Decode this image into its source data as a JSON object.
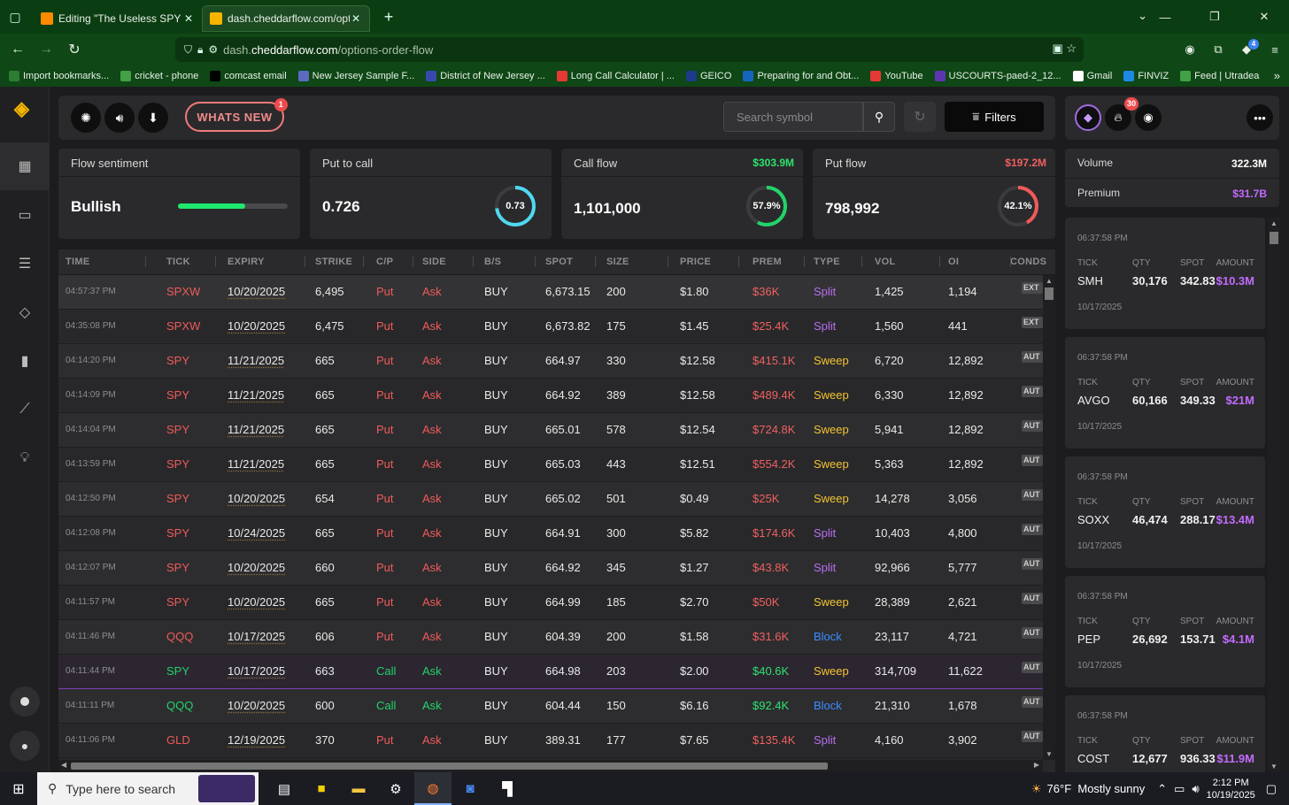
{
  "browser": {
    "tabs": [
      {
        "title": "Editing \"The Useless SPY Report\"",
        "active": false
      },
      {
        "title": "dash.cheddarflow.com/options-",
        "active": true
      }
    ],
    "url_prefix": "dash.",
    "url_domain": "cheddarflow.com",
    "url_path": "/options-order-flow",
    "bookmarks": [
      {
        "label": "Import bookmarks...",
        "color": "#2e7d32"
      },
      {
        "label": "cricket - phone",
        "color": "#43a047"
      },
      {
        "label": "comcast email",
        "color": "#000000"
      },
      {
        "label": "New Jersey Sample F...",
        "color": "#5c6bc0"
      },
      {
        "label": "District of New Jersey ...",
        "color": "#3949ab"
      },
      {
        "label": "Long Call Calculator | ...",
        "color": "#e53935"
      },
      {
        "label": "GEICO",
        "color": "#1e3a8a"
      },
      {
        "label": "Preparing for and Obt...",
        "color": "#1565c0"
      },
      {
        "label": "YouTube",
        "color": "#e53935"
      },
      {
        "label": "USCOURTS-paed-2_12...",
        "color": "#5e35b1"
      },
      {
        "label": "Gmail",
        "color": "#ffffff"
      },
      {
        "label": "FINVIZ",
        "color": "#1e88e5"
      },
      {
        "label": "Feed | Utradea",
        "color": "#43a047"
      }
    ],
    "ext_badge": "4"
  },
  "toolbar": {
    "whats_new_label": "WHATS NEW",
    "whats_new_badge": "1",
    "search_placeholder": "Search symbol",
    "filters_label": "Filters",
    "fire_badge": "30"
  },
  "summary": {
    "sentiment": {
      "label": "Flow sentiment",
      "value": "Bullish",
      "level": 0.61
    },
    "put_to_call": {
      "label": "Put to call",
      "value": "0.726",
      "ring_label": "0.73",
      "ring_fraction": 0.73
    },
    "call_flow": {
      "label": "Call flow",
      "amount": "$303.9M",
      "value": "1,101,000",
      "ring_label": "57.9%",
      "ring_fraction": 0.579
    },
    "put_flow": {
      "label": "Put flow",
      "amount": "$197.2M",
      "value": "798,992",
      "ring_label": "42.1%",
      "ring_fraction": 0.421
    },
    "volume": {
      "label": "Volume",
      "value": "322.3M"
    },
    "premium": {
      "label": "Premium",
      "value": "$31.7B"
    }
  },
  "colors": {
    "put": "#f05a5a",
    "call": "#22d36a",
    "premium_put": "#f06060",
    "premium_call": "#2ee26e",
    "split": "#b86ef0",
    "sweep": "#f4c430",
    "block": "#3b8cff",
    "purple_amount": "#c36bff",
    "ptc_ring": "#4fd8f0"
  },
  "table": {
    "columns": [
      "TIME",
      "TICK",
      "EXPIRY",
      "STRIKE",
      "C/P",
      "SIDE",
      "B/S",
      "SPOT",
      "SIZE",
      "PRICE",
      "PREM",
      "TYPE",
      "VOL",
      "OI",
      "CONDS"
    ],
    "rows": [
      {
        "time": "04:57:37 PM",
        "tick": "SPXW",
        "expiry": "10/20/2025",
        "strike": "6,495",
        "cp": "Put",
        "side": "Ask",
        "bs": "BUY",
        "spot": "6,673.15",
        "size": "200",
        "price": "$1.80",
        "prem": "$36K",
        "type": "Split",
        "vol": "1,425",
        "oi": "1,194",
        "cond": "EXT"
      },
      {
        "time": "04:35:08 PM",
        "tick": "SPXW",
        "expiry": "10/20/2025",
        "strike": "6,475",
        "cp": "Put",
        "side": "Ask",
        "bs": "BUY",
        "spot": "6,673.82",
        "size": "175",
        "price": "$1.45",
        "prem": "$25.4K",
        "type": "Split",
        "vol": "1,560",
        "oi": "441",
        "cond": "EXT"
      },
      {
        "time": "04:14:20 PM",
        "tick": "SPY",
        "expiry": "11/21/2025",
        "strike": "665",
        "cp": "Put",
        "side": "Ask",
        "bs": "BUY",
        "spot": "664.97",
        "size": "330",
        "price": "$12.58",
        "prem": "$415.1K",
        "type": "Sweep",
        "vol": "6,720",
        "oi": "12,892",
        "cond": "AUT"
      },
      {
        "time": "04:14:09 PM",
        "tick": "SPY",
        "expiry": "11/21/2025",
        "strike": "665",
        "cp": "Put",
        "side": "Ask",
        "bs": "BUY",
        "spot": "664.92",
        "size": "389",
        "price": "$12.58",
        "prem": "$489.4K",
        "type": "Sweep",
        "vol": "6,330",
        "oi": "12,892",
        "cond": "AUT"
      },
      {
        "time": "04:14:04 PM",
        "tick": "SPY",
        "expiry": "11/21/2025",
        "strike": "665",
        "cp": "Put",
        "side": "Ask",
        "bs": "BUY",
        "spot": "665.01",
        "size": "578",
        "price": "$12.54",
        "prem": "$724.8K",
        "type": "Sweep",
        "vol": "5,941",
        "oi": "12,892",
        "cond": "AUT"
      },
      {
        "time": "04:13:59 PM",
        "tick": "SPY",
        "expiry": "11/21/2025",
        "strike": "665",
        "cp": "Put",
        "side": "Ask",
        "bs": "BUY",
        "spot": "665.03",
        "size": "443",
        "price": "$12.51",
        "prem": "$554.2K",
        "type": "Sweep",
        "vol": "5,363",
        "oi": "12,892",
        "cond": "AUT"
      },
      {
        "time": "04:12:50 PM",
        "tick": "SPY",
        "expiry": "10/20/2025",
        "strike": "654",
        "cp": "Put",
        "side": "Ask",
        "bs": "BUY",
        "spot": "665.02",
        "size": "501",
        "price": "$0.49",
        "prem": "$25K",
        "type": "Sweep",
        "vol": "14,278",
        "oi": "3,056",
        "cond": "AUT"
      },
      {
        "time": "04:12:08 PM",
        "tick": "SPY",
        "expiry": "10/24/2025",
        "strike": "665",
        "cp": "Put",
        "side": "Ask",
        "bs": "BUY",
        "spot": "664.91",
        "size": "300",
        "price": "$5.82",
        "prem": "$174.6K",
        "type": "Split",
        "vol": "10,403",
        "oi": "4,800",
        "cond": "AUT"
      },
      {
        "time": "04:12:07 PM",
        "tick": "SPY",
        "expiry": "10/20/2025",
        "strike": "660",
        "cp": "Put",
        "side": "Ask",
        "bs": "BUY",
        "spot": "664.92",
        "size": "345",
        "price": "$1.27",
        "prem": "$43.8K",
        "type": "Split",
        "vol": "92,966",
        "oi": "5,777",
        "cond": "AUT"
      },
      {
        "time": "04:11:57 PM",
        "tick": "SPY",
        "expiry": "10/20/2025",
        "strike": "665",
        "cp": "Put",
        "side": "Ask",
        "bs": "BUY",
        "spot": "664.99",
        "size": "185",
        "price": "$2.70",
        "prem": "$50K",
        "type": "Sweep",
        "vol": "28,389",
        "oi": "2,621",
        "cond": "AUT"
      },
      {
        "time": "04:11:46 PM",
        "tick": "QQQ",
        "expiry": "10/17/2025",
        "strike": "606",
        "cp": "Put",
        "side": "Ask",
        "bs": "BUY",
        "spot": "604.39",
        "size": "200",
        "price": "$1.58",
        "prem": "$31.6K",
        "type": "Block",
        "vol": "23,117",
        "oi": "4,721",
        "cond": "AUT"
      },
      {
        "time": "04:11:44 PM",
        "tick": "SPY",
        "expiry": "10/17/2025",
        "strike": "663",
        "cp": "Call",
        "side": "Ask",
        "bs": "BUY",
        "spot": "664.98",
        "size": "203",
        "price": "$2.00",
        "prem": "$40.6K",
        "type": "Sweep",
        "vol": "314,709",
        "oi": "11,622",
        "cond": "AUT"
      },
      {
        "time": "04:11:11 PM",
        "tick": "QQQ",
        "expiry": "10/20/2025",
        "strike": "600",
        "cp": "Call",
        "side": "Ask",
        "bs": "BUY",
        "spot": "604.44",
        "size": "150",
        "price": "$6.16",
        "prem": "$92.4K",
        "type": "Block",
        "vol": "21,310",
        "oi": "1,678",
        "cond": "AUT"
      },
      {
        "time": "04:11:06 PM",
        "tick": "GLD",
        "expiry": "12/19/2025",
        "strike": "370",
        "cp": "Put",
        "side": "Ask",
        "bs": "BUY",
        "spot": "389.31",
        "size": "177",
        "price": "$7.65",
        "prem": "$135.4K",
        "type": "Split",
        "vol": "4,160",
        "oi": "3,902",
        "cond": "AUT"
      }
    ]
  },
  "feed": {
    "labels": {
      "tick": "TICK",
      "qty": "QTY",
      "spot": "SPOT",
      "amount": "AMOUNT"
    },
    "items": [
      {
        "time": "06:37:58 PM",
        "tick": "SMH",
        "qty": "30,176",
        "spot": "342.83",
        "amount": "$10.3M",
        "date": "10/17/2025"
      },
      {
        "time": "06:37:58 PM",
        "tick": "AVGO",
        "qty": "60,166",
        "spot": "349.33",
        "amount": "$21M",
        "date": "10/17/2025"
      },
      {
        "time": "06:37:58 PM",
        "tick": "SOXX",
        "qty": "46,474",
        "spot": "288.17",
        "amount": "$13.4M",
        "date": "10/17/2025"
      },
      {
        "time": "06:37:58 PM",
        "tick": "PEP",
        "qty": "26,692",
        "spot": "153.71",
        "amount": "$4.1M",
        "date": "10/17/2025"
      },
      {
        "time": "06:37:58 PM",
        "tick": "COST",
        "qty": "12,677",
        "spot": "936.33",
        "amount": "$11.9M",
        "date": ""
      }
    ]
  },
  "taskbar": {
    "search_placeholder": "Type here to search",
    "weather": "76°F  Mostly sunny",
    "time": "2:12 PM",
    "date": "10/19/2025"
  }
}
